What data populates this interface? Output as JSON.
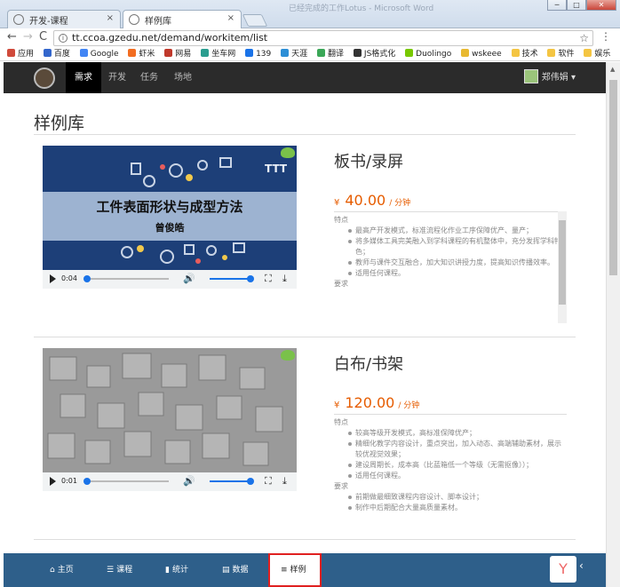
{
  "browser": {
    "tabs": [
      {
        "label": "开发-课程",
        "close": "×"
      },
      {
        "label": "样例库",
        "close": "×"
      }
    ],
    "window_title": "已经完成的工作Lotus - Microsoft Word",
    "window_buttons": {
      "min": "─",
      "max": "□",
      "close": "✕"
    },
    "nav": {
      "back": "←",
      "forward": "→",
      "reload": "C"
    },
    "url": "tt.ccoa.gzedu.net/demand/workitem/list",
    "menu": "⋮",
    "bookmarks": [
      {
        "label": "应用",
        "color": "#d04a3b"
      },
      {
        "label": "百度",
        "color": "#3366cc"
      },
      {
        "label": "Google",
        "color": "#4285f4"
      },
      {
        "label": "虾米",
        "color": "#f26d21"
      },
      {
        "label": "网易",
        "color": "#c0392b"
      },
      {
        "label": "坐车网",
        "color": "#2a9d8f"
      },
      {
        "label": "139",
        "color": "#1a73e8"
      },
      {
        "label": "天涯",
        "color": "#2c8ed6"
      },
      {
        "label": "翻译",
        "color": "#3aa757"
      },
      {
        "label": "JS格式化",
        "color": "#333333"
      },
      {
        "label": "Duolingo",
        "color": "#78c800"
      },
      {
        "label": "wskeee",
        "color": "#e8b931"
      },
      {
        "label": "技术",
        "color": "#f4c542"
      },
      {
        "label": "软件",
        "color": "#f4c542"
      },
      {
        "label": "娱乐",
        "color": "#f4c542"
      }
    ]
  },
  "app": {
    "nav": [
      {
        "label": "需求",
        "active": true
      },
      {
        "label": "开发",
        "active": false
      },
      {
        "label": "任务",
        "active": false
      },
      {
        "label": "场地",
        "active": false
      }
    ],
    "user": "郑伟娟",
    "page_title": "样例库",
    "items": [
      {
        "title": "板书/录屏",
        "currency": "¥",
        "price": "40.00",
        "unit": "/ 分钟",
        "video_title": "工件表面形状与成型方法",
        "video_subtitle": "曾俊皓",
        "time": "0:04",
        "features_label": "特点",
        "features": [
          "最高产开发模式，标准流程化作业工序保障优产、量产；",
          "将多媒体工具完美融入到学科课程的有机整体中，充分发挥学科特色；",
          "教师与课件交互融合，加大知识讲授力度，提高知识传播效率。",
          "适用任何课程。"
        ],
        "requirements_label": "要求",
        "requirements": []
      },
      {
        "title": "白布/书架",
        "currency": "¥",
        "price": "120.00",
        "unit": "/ 分钟",
        "video_title": "",
        "video_subtitle": "",
        "time": "0:01",
        "features_label": "特点",
        "features": [
          "较高等级开发模式，高标准保障优产；",
          "精细化教学内容设计，重点突出，加入动态、高端辅助素材，展示较优视觉效果；",
          "建设周期长，成本高（比蓝箱低一个等级（无需抠像））；",
          "适用任何课程。"
        ],
        "requirements_label": "要求",
        "requirements": [
          "前期做最细致课程内容设计、脚本设计；",
          "制作中后期配合大量高质量素材。"
        ]
      }
    ],
    "bottom_nav": [
      {
        "icon": "⌂",
        "label": "主页",
        "active": false
      },
      {
        "icon": "☰",
        "label": "课程",
        "active": false
      },
      {
        "icon": "▮",
        "label": "统计",
        "active": false
      },
      {
        "icon": "▤",
        "label": "数据",
        "active": false
      },
      {
        "icon": "≡",
        "label": "样例",
        "active": true
      }
    ],
    "collapse": "‹"
  }
}
